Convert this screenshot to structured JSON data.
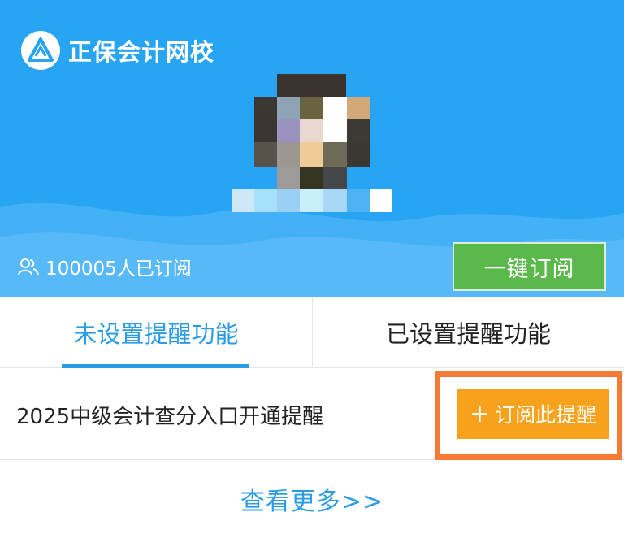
{
  "banner": {
    "brand_name": "正保会计网校",
    "subscriber_count": "100005人已订阅",
    "subscribe_all_label": "一键订阅"
  },
  "tabs": [
    {
      "label": "未设置提醒功能",
      "active": true
    },
    {
      "label": "已设置提醒功能",
      "active": false
    }
  ],
  "reminders": [
    {
      "title": "2025中级会计查分入口开通提醒",
      "action_label": "订阅此提醒"
    }
  ],
  "more_label": "查看更多>>",
  "colors": {
    "banner_blue": "#27a4f2",
    "accent_blue": "#2a9ce4",
    "subscribe_green": "#5bb84a",
    "reminder_orange": "#f7a21c",
    "highlight_orange": "#f27c37"
  },
  "icons": {
    "logo": "brand-logo-icon",
    "subscribers": "users-icon",
    "plus": "plus-icon"
  }
}
